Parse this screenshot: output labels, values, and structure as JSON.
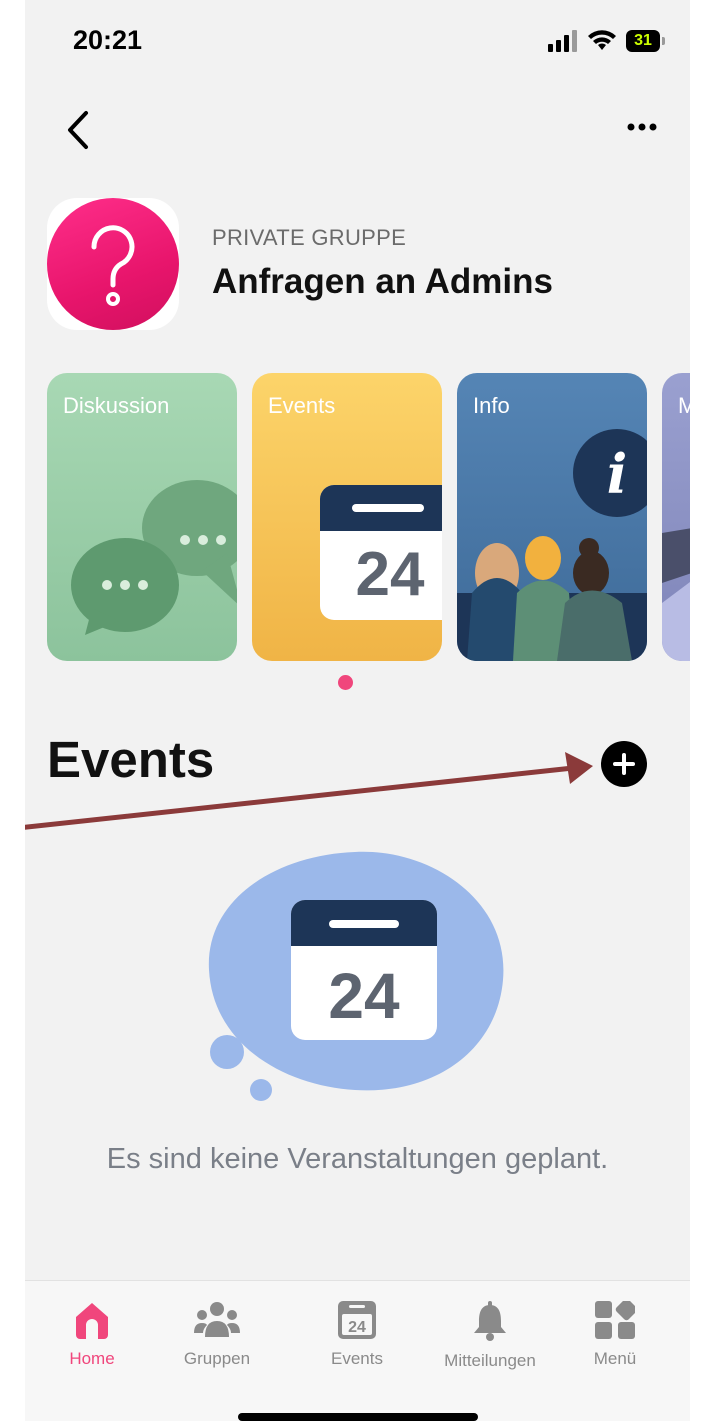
{
  "status_bar": {
    "time": "20:21",
    "battery": "31"
  },
  "group": {
    "type": "PRIVATE GRUPPE",
    "name": "Anfragen an Admins"
  },
  "tiles": [
    {
      "label": "Diskussion",
      "color": "#93c9a4"
    },
    {
      "label": "Events",
      "color": "#f5c451"
    },
    {
      "label": "Info",
      "color": "#4d78a8"
    },
    {
      "label": "M",
      "color": "#8a90c2"
    }
  ],
  "events_section": {
    "title": "Events",
    "calendar_number": "24",
    "empty_message": "Es sind keine Veranstaltungen geplant."
  },
  "tabbar": [
    {
      "label": "Home",
      "icon": "home-icon",
      "active": true
    },
    {
      "label": "Gruppen",
      "icon": "group-icon",
      "active": false
    },
    {
      "label": "Events",
      "icon": "calendar-icon",
      "active": false
    },
    {
      "label": "Mitteilungen",
      "icon": "bell-icon",
      "active": false
    },
    {
      "label": "Menü",
      "icon": "menu-grid-icon",
      "active": false
    }
  ],
  "colors": {
    "accent": "#f0467c",
    "annotation_arrow": "#8b3a3a",
    "bubble": "#9bb8ea"
  }
}
